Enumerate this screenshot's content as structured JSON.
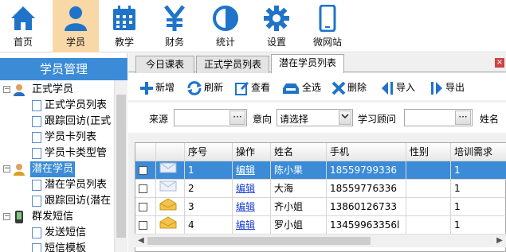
{
  "topnav": {
    "items": [
      {
        "label": "首页",
        "icon": "home-icon"
      },
      {
        "label": "学员",
        "icon": "person-icon"
      },
      {
        "label": "教学",
        "icon": "calendar-icon"
      },
      {
        "label": "财务",
        "icon": "yen-icon"
      },
      {
        "label": "统计",
        "icon": "pie-chart-icon"
      },
      {
        "label": "设置",
        "icon": "gear-icon"
      },
      {
        "label": "微网站",
        "icon": "phone-icon"
      }
    ],
    "active": "学员"
  },
  "sidebar": {
    "title": "学员管理",
    "tree": [
      {
        "label": "正式学员",
        "toggle": "⊟",
        "icon": "person-icon"
      },
      {
        "label": "正式学员列表"
      },
      {
        "label": "跟踪回访(正式"
      },
      {
        "label": "学员卡列表"
      },
      {
        "label": "学员卡类型管"
      },
      {
        "label": "潜在学员",
        "toggle": "⊟",
        "icon": "person-icon"
      },
      {
        "label": "潜在学员列表"
      },
      {
        "label": "跟踪回访(潜在"
      },
      {
        "label": "群发短信",
        "toggle": "⊟",
        "icon": "phone-icon"
      },
      {
        "label": "发送短信"
      },
      {
        "label": "短信模板"
      }
    ]
  },
  "tabs": [
    {
      "label": "今日课表"
    },
    {
      "label": "正式学员列表"
    },
    {
      "label": "潜在学员列表"
    }
  ],
  "tab_close_icon": "×",
  "toolbar": {
    "add": "新增",
    "refresh": "刷新",
    "view": "查看",
    "select_all": "全选",
    "delete": "删除",
    "import": "导入",
    "export": "导出"
  },
  "filters": {
    "source_label": "来源",
    "source_btn": "···",
    "intent_label": "意向",
    "intent_value": "请选择",
    "consultant_label": "学习顾问",
    "consultant_btn": "···",
    "name_label": "姓名"
  },
  "grid": {
    "columns": [
      "序号",
      "操作",
      "姓名",
      "手机",
      "性别",
      "培训需求"
    ],
    "rows": [
      {
        "no": "1",
        "action": "编辑",
        "name": "陈小果",
        "phone": "18559799336",
        "gender": "",
        "need": "1",
        "selected": true
      },
      {
        "no": "2",
        "action": "编辑",
        "name": "大海",
        "phone": "18559776336",
        "gender": "",
        "need": "1",
        "selected": false
      },
      {
        "no": "3",
        "action": "编辑",
        "name": "齐小姐",
        "phone": "13860126733",
        "gender": "",
        "need": "1",
        "selected": false
      },
      {
        "no": "4",
        "action": "编辑",
        "name": "罗小姐",
        "phone": "13459963356l",
        "gender": "",
        "need": "1",
        "selected": false
      }
    ]
  },
  "colors": {
    "accent": "#3b8bd6",
    "active_nav_bg": "#f9d8a8",
    "icon_blue": "#1f74c9"
  }
}
